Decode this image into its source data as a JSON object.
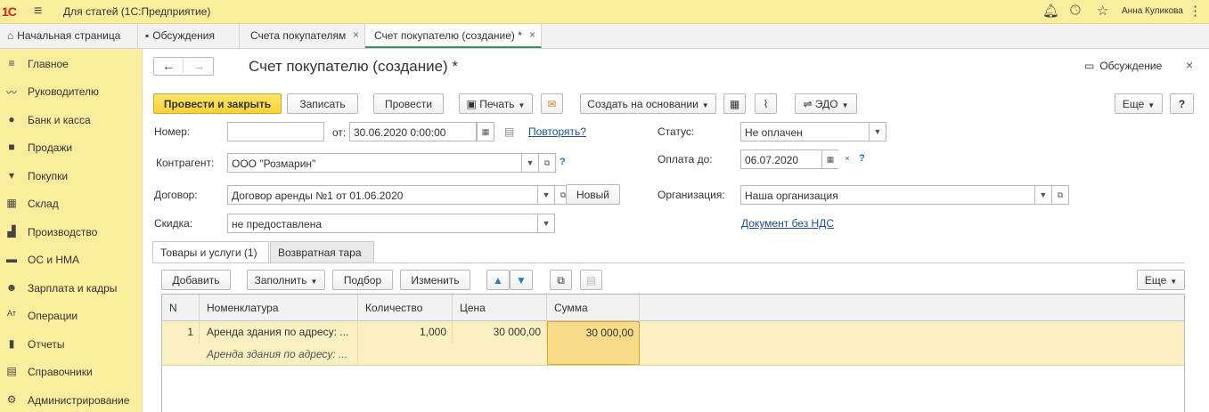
{
  "topbar": {
    "logo": "1С",
    "title": "Для статей  (1С:Предприятие)",
    "user": "Анна Куликова"
  },
  "tabs": [
    {
      "label": "Начальная страница"
    },
    {
      "label": "Обсуждения"
    },
    {
      "label": "Счета покупателям"
    },
    {
      "label": "Счет покупателю (создание) *"
    }
  ],
  "sidebar": {
    "items": [
      {
        "label": "Главное",
        "icon": "menu-icon"
      },
      {
        "label": "Руководителю",
        "icon": "chart-line-icon"
      },
      {
        "label": "Банк и касса",
        "icon": "coin-icon"
      },
      {
        "label": "Продажи",
        "icon": "bag-icon"
      },
      {
        "label": "Покупки",
        "icon": "cart-icon"
      },
      {
        "label": "Склад",
        "icon": "warehouse-icon"
      },
      {
        "label": "Производство",
        "icon": "factory-icon"
      },
      {
        "label": "ОС и НМА",
        "icon": "truck-icon"
      },
      {
        "label": "Зарплата и кадры",
        "icon": "person-icon"
      },
      {
        "label": "Операции",
        "icon": "operations-icon"
      },
      {
        "label": "Отчеты",
        "icon": "bar-chart-icon"
      },
      {
        "label": "Справочники",
        "icon": "book-icon"
      },
      {
        "label": "Администрирование",
        "icon": "gear-icon"
      }
    ]
  },
  "form": {
    "title": "Счет покупателю (создание) *",
    "discuss_label": "Обсуждение",
    "toolbar": {
      "post_close": "Провести и закрыть",
      "save": "Записать",
      "post": "Провести",
      "print": "Печать",
      "create_based": "Создать на основании",
      "edo": "ЭДО",
      "more": "Еще",
      "help": "?"
    },
    "fields": {
      "number_label": "Номер:",
      "number_value": "",
      "from_label": "от:",
      "date_value": "30.06.2020  0:00:00",
      "repeat_link": "Повторять?",
      "status_label": "Статус:",
      "status_value": "Не оплачен",
      "contractor_label": "Контрагент:",
      "contractor_value": "ООО \"Розмарин\"",
      "pay_until_label": "Оплата до:",
      "pay_until_value": "06.07.2020",
      "contract_label": "Договор:",
      "contract_value": "Договор аренды №1 от 01.06.2020",
      "new_button": "Новый",
      "org_label": "Организация:",
      "org_value": "Наша организация",
      "discount_label": "Скидка:",
      "discount_value": "не предоставлена",
      "vat_link": "Документ без НДС"
    },
    "inner_tabs": [
      {
        "label": "Товары и услуги (1)"
      },
      {
        "label": "Возвратная тара"
      }
    ],
    "table_toolbar": {
      "add": "Добавить",
      "fill": "Заполнить",
      "pick": "Подбор",
      "change": "Изменить",
      "more": "Еще"
    },
    "table": {
      "columns": [
        "N",
        "Номенклатура",
        "Количество",
        "Цена",
        "Сумма"
      ],
      "rows": [
        {
          "n": "1",
          "item": "Аренда здания по адресу: ...",
          "item_desc": "Аренда здания по адресу: ...",
          "qty": "1,000",
          "price": "30 000,00",
          "sum": "30 000,00"
        }
      ]
    }
  },
  "colors": {
    "accent_yellow": "#fbed9e",
    "primary_button": "#f6d233",
    "link": "#1a4fa0",
    "active_tab_underline": "#3a8f5a"
  }
}
